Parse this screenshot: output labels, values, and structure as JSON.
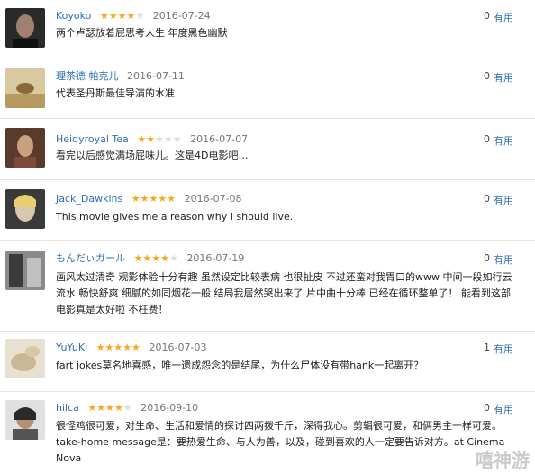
{
  "comments": [
    {
      "name": "Koyoko",
      "rating": 4,
      "date": "2016-07-24",
      "text": "两个卢瑟放着屁思考人生 年度黑色幽默",
      "count": "0",
      "useful": "有用"
    },
    {
      "name": "理茶德 帕克儿",
      "rating": 0,
      "date": "2016-07-11",
      "text": "代表圣丹斯最佳导演的水准",
      "count": "0",
      "useful": "有用"
    },
    {
      "name": "Heidyroyal Tea",
      "rating": 2,
      "date": "2016-07-07",
      "text": "看完以后感觉满场屁味儿。这是4D电影吧…",
      "count": "0",
      "useful": "有用"
    },
    {
      "name": "Jack_Dawkins",
      "rating": 5,
      "date": "2016-07-08",
      "text": "This movie gives me a reason why I should live.",
      "count": "0",
      "useful": "有用"
    },
    {
      "name": "もんだぃガール",
      "rating": 4,
      "date": "2016-07-19",
      "text": "画风太过清奇 观影体验十分有趣 虽然设定比较表病 也很扯皮 不过还蛮对我胃口的www 中间一段如行云流水 畅快舒爽 细腻的如同烟花一般 结局我居然哭出来了 片中曲十分棒 已经在循环整单了！ 能看到这部电影真是太好啦 不枉费！",
      "count": "0",
      "useful": "有用"
    },
    {
      "name": "YuYuKi",
      "rating": 5,
      "date": "2016-07-03",
      "text": "fart jokes莫名地喜感，唯一遗成怨念的是结尾，为什么尸体没有带hank一起离开？",
      "count": "1",
      "useful": "有用"
    },
    {
      "name": "hilca",
      "rating": 4,
      "date": "2016-09-10",
      "text": "很怪鸡很可爱，对生命、生活和爱情的探讨四两拨千斤，深得我心。剪辑很可爱，和俩男主一样可爱。take-home message是：要热爱生命、与人为善，以及，碰到喜欢的人一定要告诉对方。at Cinema Nova",
      "count": "0",
      "useful": "有用"
    }
  ],
  "star_filled": "★",
  "star_empty": "★",
  "colors": {
    "star_filled": "#f5a623",
    "star_empty": "#dddddd",
    "name": "#2f6fb6",
    "useful": "#2f6fb6"
  },
  "watermark": "嘻神游"
}
